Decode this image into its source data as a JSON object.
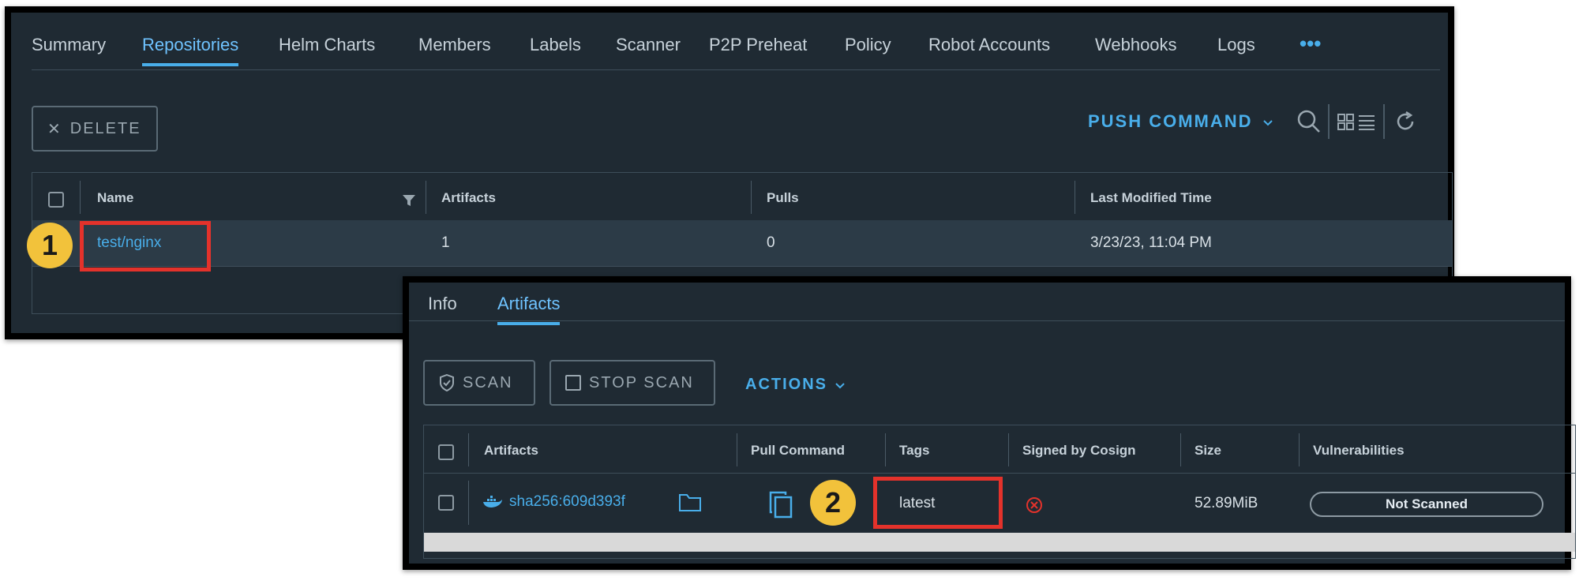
{
  "repo_panel": {
    "tabs": [
      "Summary",
      "Repositories",
      "Helm Charts",
      "Members",
      "Labels",
      "Scanner",
      "P2P Preheat",
      "Policy",
      "Robot Accounts",
      "Webhooks",
      "Logs"
    ],
    "active_tab": "Repositories",
    "delete_label": "DELETE",
    "push_command_label": "PUSH COMMAND",
    "columns": [
      "Name",
      "Artifacts",
      "Pulls",
      "Last Modified Time"
    ],
    "rows": [
      {
        "name": "test/nginx",
        "artifacts": "1",
        "pulls": "0",
        "modified": "3/23/23, 11:04 PM"
      }
    ],
    "step_badge": "1"
  },
  "artifact_panel": {
    "tabs": [
      "Info",
      "Artifacts"
    ],
    "active_tab": "Artifacts",
    "scan_label": "SCAN",
    "stop_scan_label": "STOP SCAN",
    "actions_label": "ACTIONS",
    "columns": [
      "Artifacts",
      "Pull Command",
      "Tags",
      "Signed by Cosign",
      "Size",
      "Vulnerabilities"
    ],
    "rows": [
      {
        "digest": "sha256:609d393f",
        "tag": "latest",
        "size": "52.89MiB",
        "vulnerabilities": "Not Scanned"
      }
    ],
    "step_badge": "2"
  },
  "icons": [
    "close-icon",
    "chevron-down-icon",
    "search-icon",
    "card-view-icon",
    "list-view-icon",
    "refresh-icon",
    "more-icon",
    "filter-icon",
    "shield-icon",
    "docker-icon",
    "folder-icon",
    "copy-icon",
    "unsigned-icon"
  ],
  "colors": {
    "accent": "#49aeea",
    "highlight": "#e4322b",
    "badge": "#f2c23b",
    "panel_bg": "#1f2a33"
  }
}
